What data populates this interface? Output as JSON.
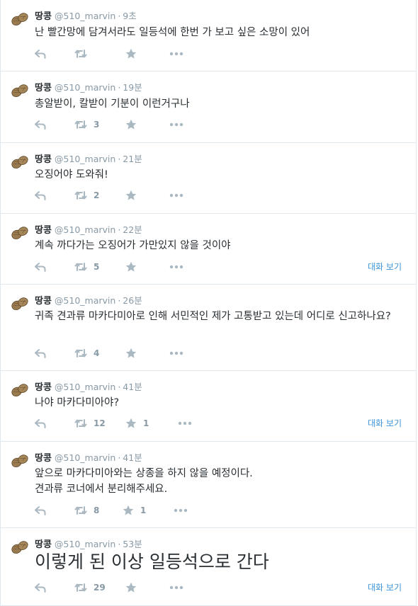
{
  "colors": {
    "accent": "#3b94d9",
    "muted": "#8899a6",
    "text": "#292f33",
    "border": "#e1e8ed"
  },
  "icons": {
    "reply": "reply-icon",
    "retweet": "retweet-icon",
    "favorite": "star-icon",
    "more": "more-dots-icon",
    "avatar": "peanut-avatar-icon"
  },
  "tweets": [
    {
      "name": "땅콩",
      "handle": "@510_marvin",
      "sep": "·",
      "time": "9초",
      "text": "난 빨간망에 담겨서라도 일등석에 한번 가 보고 싶은 소망이 있어",
      "retweets": "",
      "favorites": "",
      "convo": ""
    },
    {
      "name": "땅콩",
      "handle": "@510_marvin",
      "sep": "·",
      "time": "19분",
      "text": "총알받이, 칼받이 기분이 이런거구나",
      "retweets": "3",
      "favorites": "",
      "convo": ""
    },
    {
      "name": "땅콩",
      "handle": "@510_marvin",
      "sep": "·",
      "time": "21분",
      "text": "오징어야 도와줘!",
      "retweets": "2",
      "favorites": "",
      "convo": ""
    },
    {
      "name": "땅콩",
      "handle": "@510_marvin",
      "sep": "·",
      "time": "22분",
      "text": "계속 까다가는 오징어가 가만있지 않을 것이야",
      "retweets": "5",
      "favorites": "",
      "convo": "대화 보기"
    },
    {
      "name": "땅콩",
      "handle": "@510_marvin",
      "sep": "·",
      "time": "26분",
      "text": "귀족 견과류 마카다미아로 인해 서민적인 제가 고통받고 있는데 어디로 신고하나요?",
      "retweets": "4",
      "favorites": "",
      "convo": ""
    },
    {
      "name": "땅콩",
      "handle": "@510_marvin",
      "sep": "·",
      "time": "41분",
      "text": "나야 마카다미아야?",
      "retweets": "12",
      "favorites": "1",
      "convo": "대화 보기"
    },
    {
      "name": "땅콩",
      "handle": "@510_marvin",
      "sep": "·",
      "time": "41분",
      "text": "앞으로 마카다미아와는 상종을 하지 않을 예정이다.\n견과류 코너에서 분리해주세요.",
      "retweets": "8",
      "favorites": "1",
      "convo": ""
    },
    {
      "name": "땅콩",
      "handle": "@510_marvin",
      "sep": "·",
      "time": "53분",
      "text": "이렇게 된 이상 일등석으로 간다",
      "retweets": "29",
      "favorites": "",
      "convo": "대화 보기"
    }
  ]
}
